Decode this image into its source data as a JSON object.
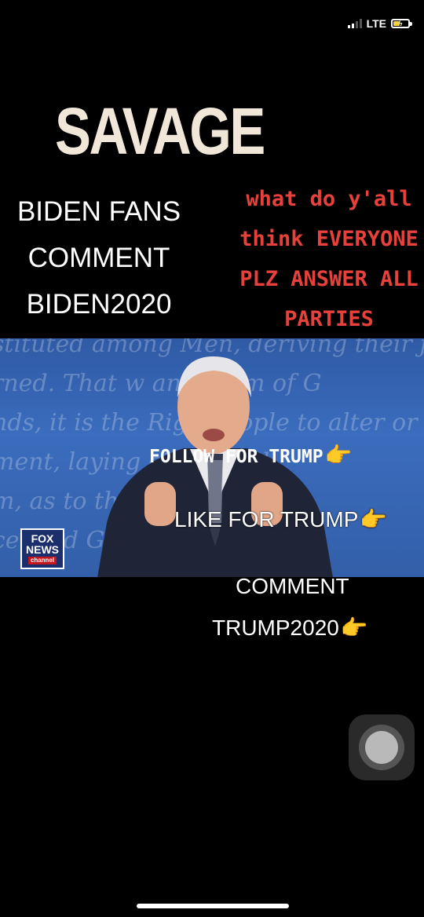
{
  "status_bar": {
    "network": "LTE",
    "battery_charging": true
  },
  "title": "SAVAGE",
  "left_text": {
    "line1": "BIDEN FANS",
    "line2": "COMMENT",
    "line3": "BIDEN2020"
  },
  "right_text": {
    "line1": "what do y'all",
    "line2": "think EVERYONE",
    "line3": "PLZ ANSWER ALL",
    "line4": "PARTIES"
  },
  "video": {
    "background_script": [
      "stituted among Men, deriving their just",
      "rned. That w    any Form of G",
      "nds, it is the Righ    People to alter or",
      "ment, laying    ciples and",
      "m, as to the    likely to effe",
      "ce    feed    Government"
    ],
    "logo": {
      "line1": "FOX",
      "line2": "NEWS",
      "line3": "channel"
    }
  },
  "overlay": {
    "follow": "FOLLOW FOR TRUMP",
    "like": "LIKE FOR TRUMP",
    "comment_line1": "COMMENT",
    "comment_line2": "TRUMP2020"
  },
  "icons": {
    "pointing": "backhand-index-pointing-right",
    "assistive_touch": "assistive-touch-button"
  },
  "colors": {
    "title": "#f1e7d9",
    "right_text": "#e8413c",
    "emoji": "#f7b731"
  }
}
